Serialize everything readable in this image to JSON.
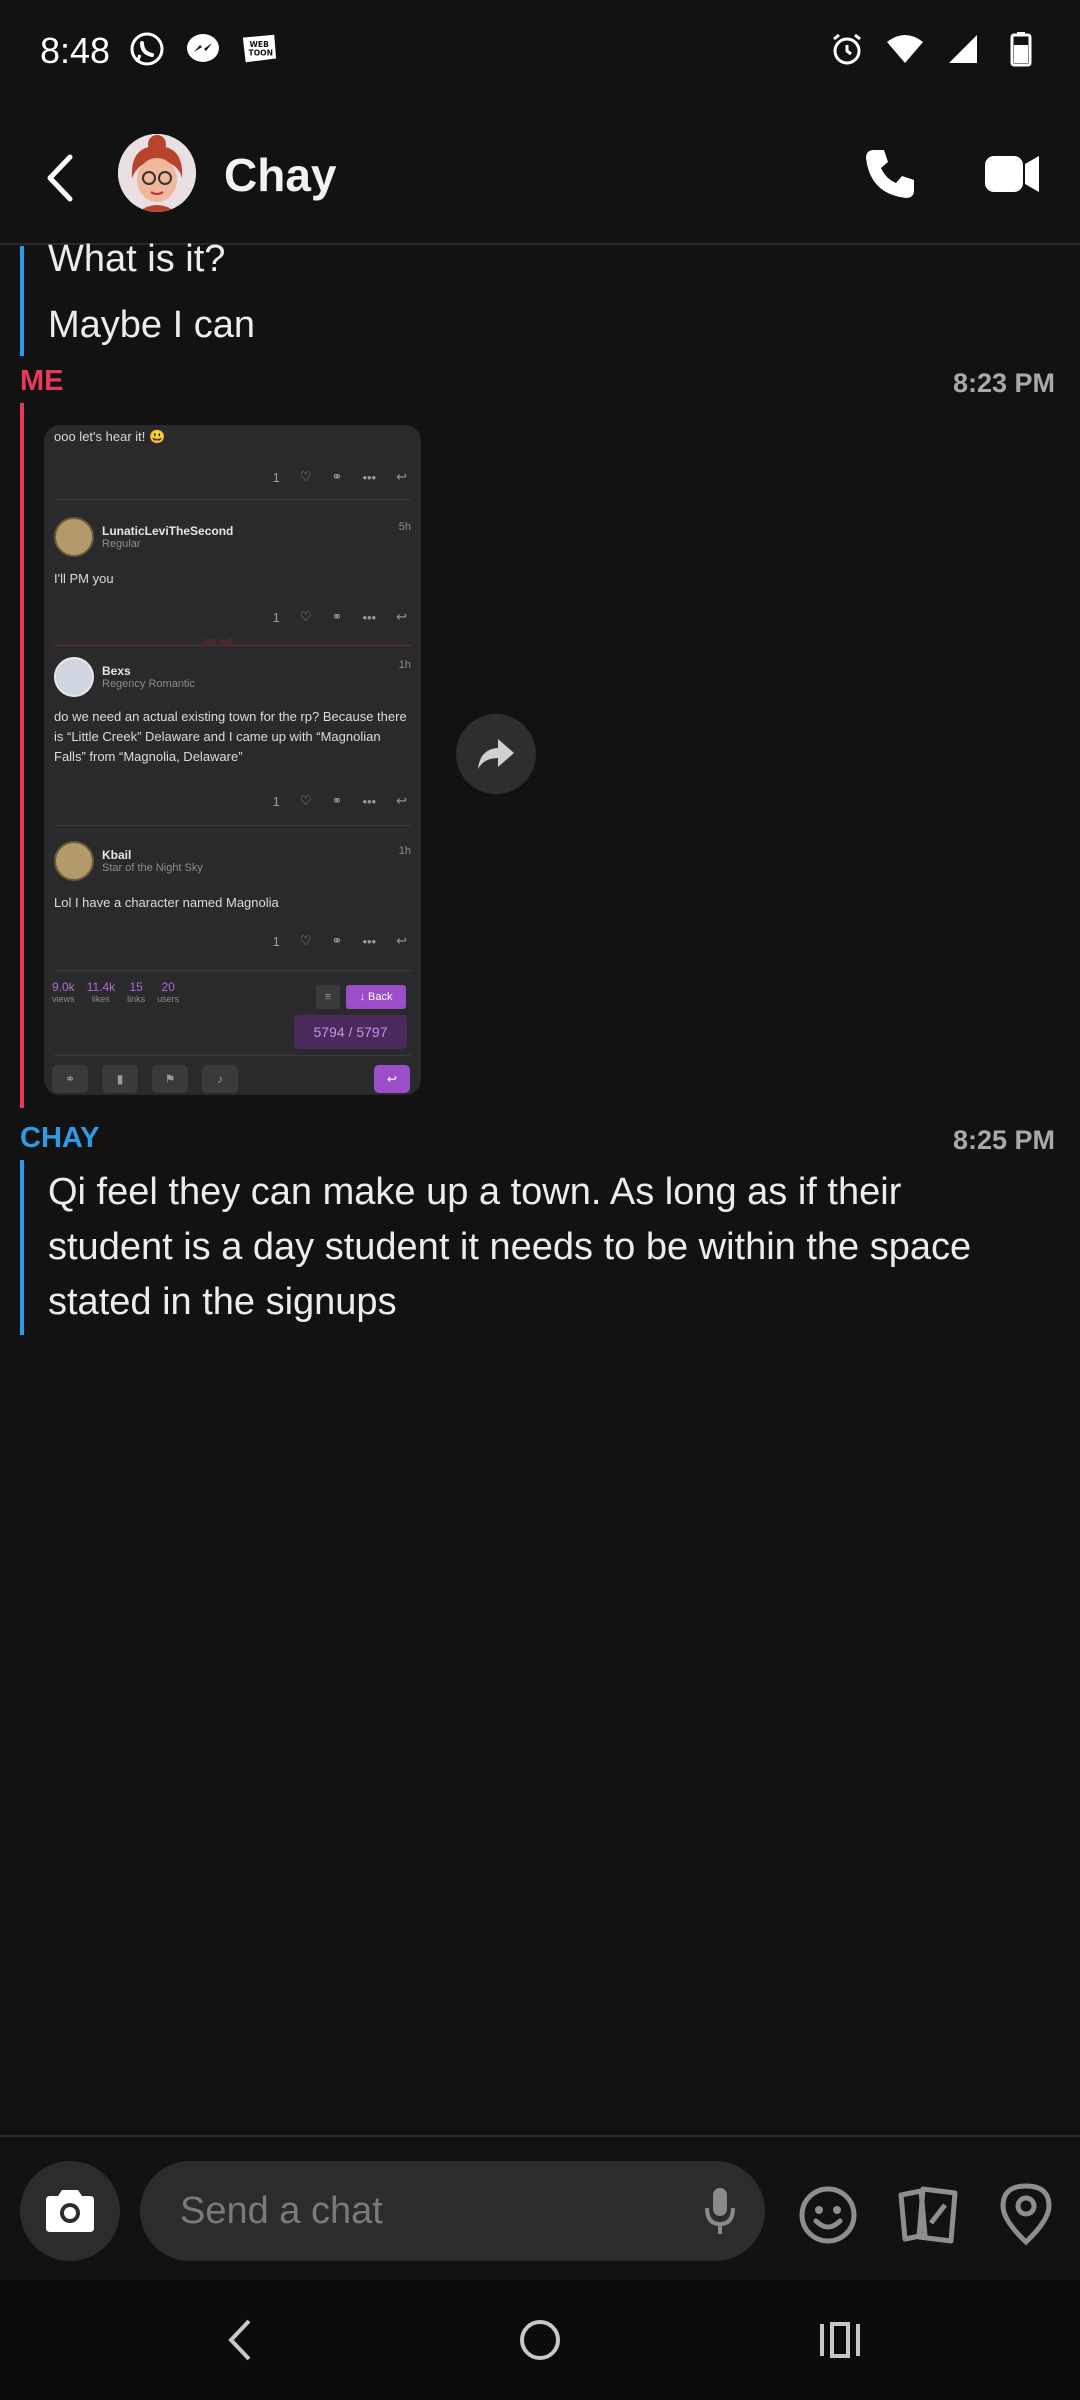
{
  "status_bar": {
    "time": "8:48",
    "left_icons": [
      "whatsapp-icon",
      "messenger-icon",
      "webtoon-icon"
    ],
    "right_icons": [
      "alarm-icon",
      "wifi-icon",
      "signal-icon",
      "battery-icon"
    ]
  },
  "header": {
    "contact_name": "Chay"
  },
  "messages": [
    {
      "sender": "",
      "lines": [
        "What is it?",
        "Maybe I can"
      ]
    },
    {
      "sender": "ME",
      "time": "8:23 PM",
      "type": "image"
    },
    {
      "sender": "CHAY",
      "time": "8:25 PM",
      "lines": [
        "Qi feel they can make up a town. As long as if their",
        "student is a day student it needs to be within the space",
        "stated in the signups"
      ]
    }
  ],
  "shared_screenshot": {
    "top_text": "ooo let's hear it! 😃",
    "posts": [
      {
        "name": "LunaticLeviTheSecond",
        "role": "Regular",
        "time": "5h",
        "body": "I'll PM you",
        "likes": "1"
      },
      {
        "name": "Bexs",
        "role": "Regency Romantic",
        "time": "1h",
        "body": "do we need an actual existing town for the rp? Because there is “Little Creek” Delaware and I came up with “Magnolian Falls” from “Magnolia, Delaware”",
        "likes": "1"
      },
      {
        "name": "Kbail",
        "role": "Star of the Night Sky",
        "time": "1h",
        "body": "Lol I have a character named Magnolia",
        "likes": "1"
      }
    ],
    "top_likes": "1",
    "unread_label": "last visit",
    "stats": [
      {
        "n": "9.0k",
        "l": "views"
      },
      {
        "n": "11.4k",
        "l": "likes"
      },
      {
        "n": "15",
        "l": "links"
      },
      {
        "n": "20",
        "l": "users"
      }
    ],
    "back_label": "↓ Back",
    "progress": "5794 / 5797"
  },
  "composer": {
    "placeholder": "Send a chat"
  },
  "colors": {
    "me": "#e8395a",
    "chay": "#2f9be8",
    "background": "#121212"
  }
}
